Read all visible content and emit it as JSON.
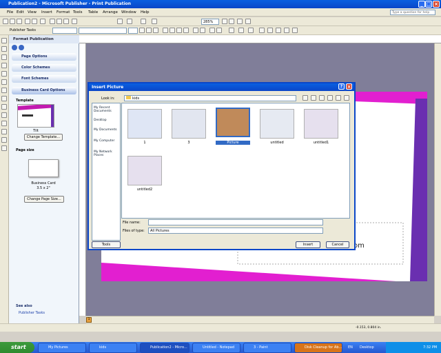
{
  "window": {
    "title": "Publication2 - Microsoft Publisher - Print Publication"
  },
  "menu": [
    "File",
    "Edit",
    "View",
    "Insert",
    "Format",
    "Tools",
    "Table",
    "Arrange",
    "Window",
    "Help"
  ],
  "help_box": {
    "placeholder": "Type a question for help"
  },
  "toolbar": {
    "zoom": "285%",
    "publisher_tasks": "Publisher Tasks"
  },
  "taskpane": {
    "title": "Format Publication",
    "sections": [
      "Page Options",
      "Color Schemes",
      "Font Schemes",
      "Business Card Options"
    ],
    "template_label": "Template",
    "template_name": "Tilt",
    "change_template": "Change Template...",
    "page_size_label": "Page size",
    "page_size_name": "Business Card",
    "page_size_dims": "3.5 x 2\"",
    "change_page_size": "Change Page Size...",
    "see_also": "See also",
    "publisher_tasks_link": "Publisher Tasks"
  },
  "dialog": {
    "title": "Insert Picture",
    "look_in_label": "Look in:",
    "look_in_value": "kids",
    "places": [
      "My Recent Documents",
      "Desktop",
      "My Documents",
      "My Computer",
      "My Network Places"
    ],
    "files": [
      "1",
      "3",
      "Picture",
      "untitled",
      "untitled1",
      "untitled2"
    ],
    "file_name_label": "File name:",
    "file_name_value": "",
    "files_of_type_label": "Files of type:",
    "files_of_type_value": "All Pictures",
    "tools": "Tools",
    "insert": "Insert",
    "cancel": "Cancel"
  },
  "status": {
    "coords": "-0.153, 0.804 in.",
    "page_tab": "1"
  },
  "taskbar": {
    "start": "start",
    "tasks": [
      "My Pictures",
      "kids",
      "Publication2 - Micro...",
      "Untitled - Notepad",
      "3 - Paint",
      "Disk Cleanup for Ab..."
    ],
    "lang": "EN",
    "desktop": "Desktop",
    "clock": "7:32 PM"
  },
  "canvas": {
    "text_fragment": "om"
  }
}
